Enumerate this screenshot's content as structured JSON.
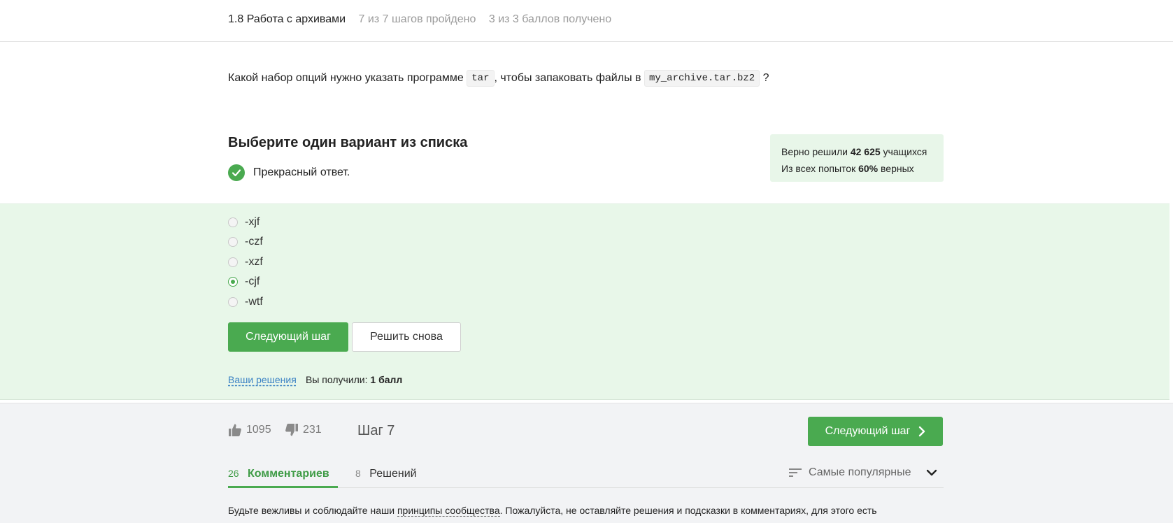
{
  "header": {
    "lesson_title": "1.8 Работа с архивами",
    "steps_progress": "7 из 7 шагов пройдено",
    "points_progress": "3 из 3 баллов  получено"
  },
  "question": {
    "text_before": "Какой набор опций нужно указать программе",
    "code1": "tar",
    "text_middle": ", чтобы запаковать файлы в",
    "code2": "my_archive.tar.bz2",
    "text_after": "?"
  },
  "quiz": {
    "title": "Выберите один вариант из списка",
    "feedback": "Прекрасный ответ.",
    "options": [
      {
        "label": "-xjf",
        "selected": false
      },
      {
        "label": "-czf",
        "selected": false
      },
      {
        "label": "-xzf",
        "selected": false
      },
      {
        "label": "-cjf",
        "selected": true
      },
      {
        "label": "-wtf",
        "selected": false
      }
    ],
    "next_button": "Следующий шаг",
    "retry_button": "Решить снова",
    "your_solutions_link": "Ваши решения",
    "score_prefix": "Вы получили:",
    "score_value": "1 балл"
  },
  "stats": {
    "solved_prefix": "Верно решили",
    "solved_count": "42 625",
    "solved_suffix": "учащихся",
    "attempts_prefix": "Из всех попыток",
    "attempts_percent": "60%",
    "attempts_suffix": "верных"
  },
  "footer": {
    "likes": "1095",
    "dislikes": "231",
    "step_label": "Шаг 7",
    "next_step_button": "Следующий шаг",
    "tabs": [
      {
        "count": "26",
        "label": "Комментариев",
        "active": true
      },
      {
        "count": "8",
        "label": "Решений",
        "active": false
      }
    ],
    "sort_label": "Самые популярные",
    "rules_prefix": "Будьте вежливы и соблюдайте наши",
    "rules_link": "принципы сообщества",
    "rules_suffix": ". Пожалуйста, не оставляйте решения и подсказки в комментариях, для этого есть"
  },
  "colors": {
    "accent_green": "#4aaa50",
    "panel_green": "#e8f7e9",
    "link_blue": "#3b82c4"
  },
  "icons": [
    "check-icon",
    "thumbs-up-icon",
    "thumbs-down-icon",
    "chevron-right-icon",
    "sort-icon",
    "chevron-down-icon"
  ]
}
